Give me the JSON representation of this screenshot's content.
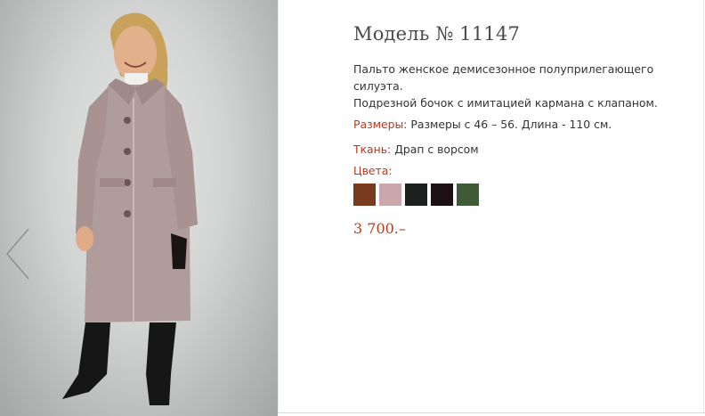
{
  "product": {
    "title": "Модель № 11147",
    "description_line1": "Пальто женское демисезонное полуприлегающего силуэта.",
    "description_line2": "Подрезной бочок с имитацией кармана с клапаном.",
    "sizes_label": "Размеры:",
    "sizes_value": "Размеры с 46 – 56. Длина - 110 см.",
    "fabric_label": "Ткань:",
    "fabric_value": "Драп с ворсом",
    "colors_label": "Цвета:",
    "colors": [
      "#7a3a1e",
      "#c9a7ad",
      "#1e1f1f",
      "#1c1014",
      "#3f5b36"
    ],
    "price": "3 700.–"
  },
  "gallery": {
    "prev_icon": "chevron-left-icon"
  }
}
